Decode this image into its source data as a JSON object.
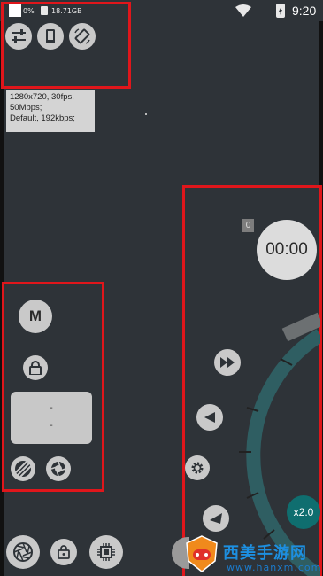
{
  "status_bar": {
    "battery_percent": "0%",
    "storage_free": "18.71GB",
    "time": "9:20"
  },
  "recording_info": {
    "video": "1280x720, 30fps,",
    "bitrate": "50Mbps;",
    "audio": "Default, 192kbps;"
  },
  "timer": {
    "elapsed": "00:00",
    "clip_count": "0"
  },
  "manual": {
    "mode_label": "M",
    "panel_line1": "-",
    "panel_line2": "-"
  },
  "zoom": {
    "level": "x2.0"
  },
  "watermark": {
    "brand": "西美手游网",
    "url": "www.hanxm.com"
  },
  "colors": {
    "background": "#2e3338",
    "highlight_frame": "#e0161b",
    "dial": "#2f5e62",
    "zoom_button": "#0f6e6f"
  },
  "icons": {
    "settings": "sliders-icon",
    "orientation": "phone-portrait-icon",
    "rotate": "screen-rotation-icon",
    "lock": "lock-icon",
    "stripes": "stripes-filter-icon",
    "aperture": "aperture-icon",
    "fast_forward": "fast-forward-icon",
    "rewind": "rewind-icon",
    "gear": "gear-icon",
    "triangle": "triangle-icon",
    "shutter": "shutter-icon",
    "gallery_lock": "gallery-lock-icon",
    "chip": "chip-icon"
  }
}
